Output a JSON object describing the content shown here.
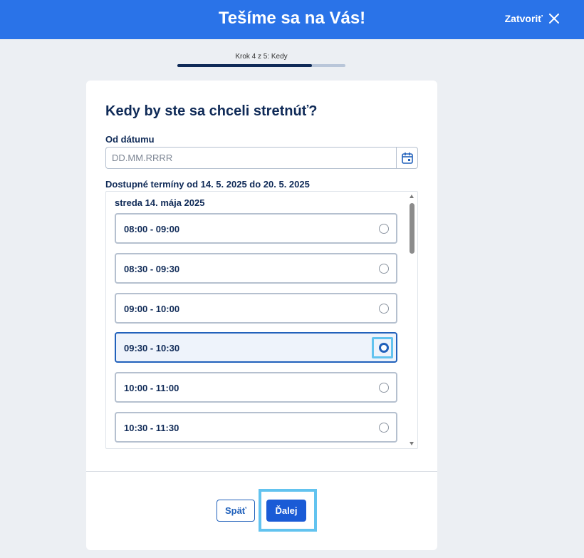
{
  "header": {
    "title": "Tešíme sa na Vás!",
    "close_label": "Zatvoriť"
  },
  "progress": {
    "label": "Krok 4 z 5: Kedy",
    "current_step": 4,
    "total_steps": 5,
    "fill_fraction": 0.8
  },
  "form": {
    "title": "Kedy by ste sa chceli stretnúť?",
    "date_label": "Od dátumu",
    "date_value": "",
    "date_placeholder": "DD.MM.RRRR",
    "available_label": "Dostupné termíny od 14. 5. 2025 do 20. 5. 2025",
    "day_label": "streda 14. mája 2025",
    "slots": [
      {
        "label": "08:00 - 09:00",
        "selected": false
      },
      {
        "label": "08:30 - 09:30",
        "selected": false
      },
      {
        "label": "09:00 - 10:00",
        "selected": false
      },
      {
        "label": "09:30 - 10:30",
        "selected": true
      },
      {
        "label": "10:00 - 11:00",
        "selected": false
      },
      {
        "label": "10:30 - 11:30",
        "selected": false
      }
    ]
  },
  "actions": {
    "back_label": "Späť",
    "next_label": "Ďalej"
  },
  "icons": {
    "close": "close-icon",
    "calendar": "calendar-icon"
  },
  "colors": {
    "header": "#2a73e8",
    "primary": "#1a5bd6",
    "focus": "#62c3ef",
    "heading": "#0f2a57"
  }
}
